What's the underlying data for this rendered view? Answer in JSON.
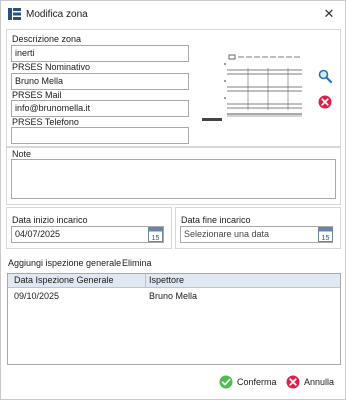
{
  "window": {
    "title": "Modifica zona"
  },
  "zone": {
    "description_label": "Descrizione zona",
    "description_value": "inerti",
    "prses_name_label": "PRSES Nominativo",
    "prses_name_value": "Bruno Mella",
    "prses_mail_label": "PRSES Mail",
    "prses_mail_value": "info@brunomella.it",
    "prses_phone_label": "PRSES Telefono",
    "prses_phone_value": ""
  },
  "notes": {
    "label": "Note",
    "value": ""
  },
  "dates": {
    "start_label": "Data inizio incarico",
    "start_value": "04/07/2025",
    "end_label": "Data fine incarico",
    "end_placeholder": "Selezionare una data",
    "calendar_day": "15"
  },
  "inspections": {
    "add_label": "Aggiungi ispezione generale",
    "delete_label": "Elimina",
    "columns": [
      "Data Ispezione Generale",
      "Ispettore"
    ],
    "rows": [
      {
        "date": "09/10/2025",
        "inspector": "Bruno Mella"
      }
    ]
  },
  "footer": {
    "confirm_label": "Conferma",
    "cancel_label": "Annulla"
  },
  "icons": {
    "app": "table-icon",
    "search": "magnifier-icon",
    "delete": "red-x-icon",
    "confirm": "green-check-icon",
    "cancel": "red-x-circle-icon"
  }
}
